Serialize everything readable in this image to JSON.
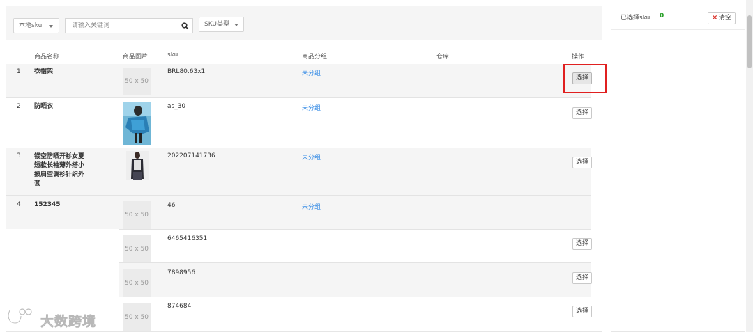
{
  "toolbar": {
    "sku_dropdown_label": "本地sku",
    "search_placeholder": "请输入关键词",
    "sku_type_label": "SKU类型"
  },
  "table": {
    "columns": [
      "商品名称",
      "商品图片",
      "sku",
      "商品分组",
      "仓库",
      "操作"
    ],
    "rows": [
      {
        "index": "1",
        "name": "衣帽架",
        "image": "50 x 50",
        "sku": "BRL80.63x1",
        "group": "未分组",
        "warehouse": "",
        "action": "选择"
      },
      {
        "index": "2",
        "name": "防晒衣",
        "image": "",
        "sku": "as_30",
        "group": "未分组",
        "warehouse": "",
        "action": "选择"
      },
      {
        "index": "3",
        "name": "镂空防晒开衫女夏短款长袖薄外搭小披肩空调衫针织外套",
        "name_lines": [
          "镂空防晒开衫女夏",
          "短款长袖薄外搭小",
          "披肩空调衫针织外",
          "套"
        ],
        "image": "",
        "sku": "202207141736",
        "group": "未分组",
        "warehouse": "",
        "action": "选择"
      },
      {
        "index": "4",
        "name": "152345",
        "image": "50 x 50",
        "sku": "46",
        "group": "未分组",
        "warehouse": "",
        "action": ""
      },
      {
        "index": "",
        "name": "",
        "image": "50 x 50",
        "sku": "6465416351",
        "group": "",
        "warehouse": "",
        "action": "选择"
      },
      {
        "index": "",
        "name": "",
        "image": "50 x 50",
        "sku": "7898956",
        "group": "",
        "warehouse": "",
        "action": "选择"
      },
      {
        "index": "",
        "name": "",
        "image": "50 x 50",
        "sku": "874684",
        "group": "",
        "warehouse": "",
        "action": "选择"
      }
    ]
  },
  "selected_panel": {
    "title": "已选择sku",
    "count": "0",
    "clear_label": "清空"
  },
  "watermark": "大数跨境",
  "colors": {
    "link": "#3a8ee6",
    "count": "#2aa02a",
    "highlight": "#e02020",
    "clear_x": "#d9322a"
  }
}
